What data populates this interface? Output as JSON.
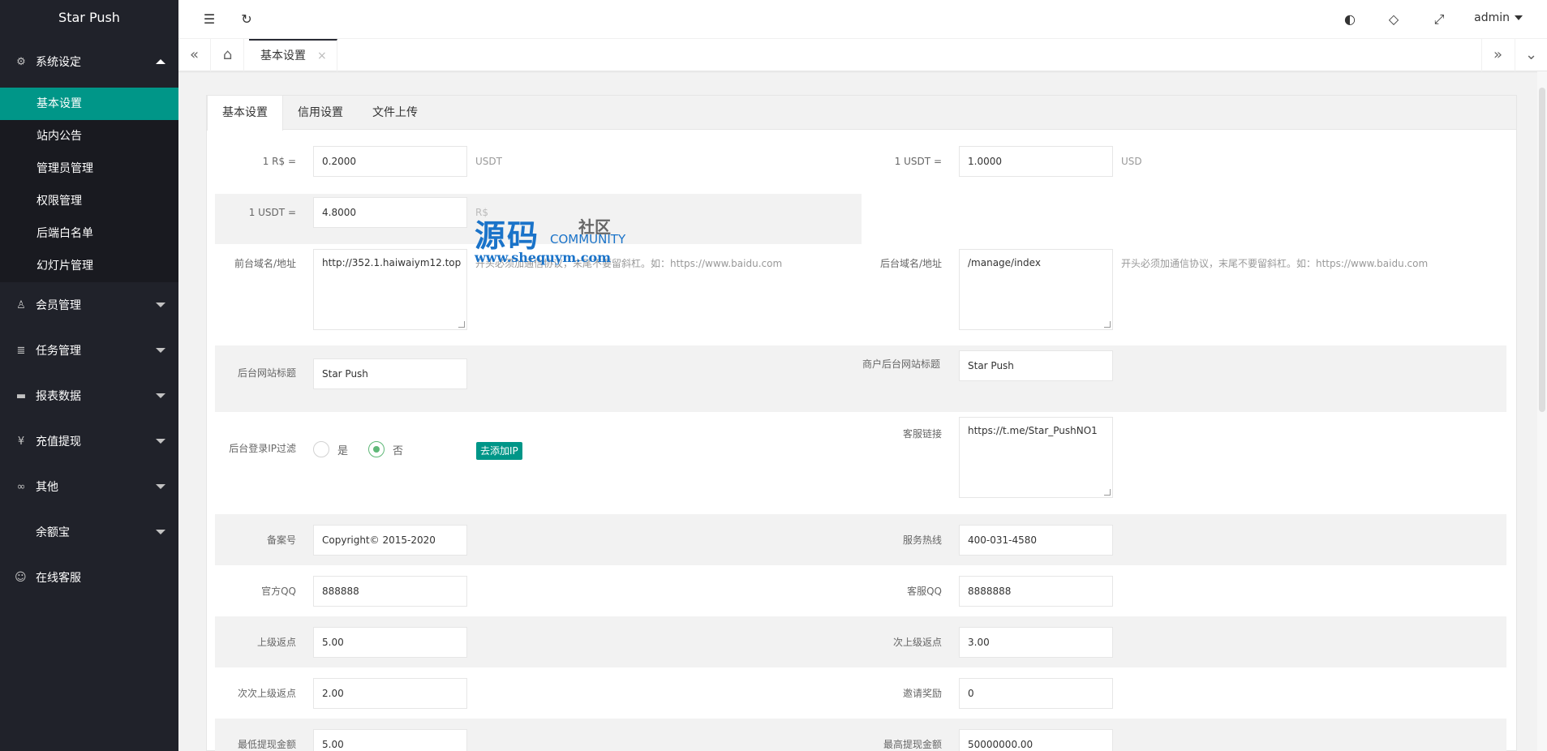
{
  "app": {
    "title": "Star Push"
  },
  "sidebar": {
    "groups": [
      {
        "label": "系统设定",
        "icon": "gear-icon",
        "expanded": true,
        "items": [
          "基本设置",
          "站内公告",
          "管理员管理",
          "权限管理",
          "后端白名单",
          "幻灯片管理"
        ],
        "active": "基本设置"
      },
      {
        "label": "会员管理",
        "icon": "user-icon"
      },
      {
        "label": "任务管理",
        "icon": "list-icon"
      },
      {
        "label": "报表数据",
        "icon": "report-icon"
      },
      {
        "label": "充值提现",
        "icon": "yen-icon"
      },
      {
        "label": "其他",
        "icon": "link-icon"
      },
      {
        "label": "余额宝",
        "icon": ""
      },
      {
        "label": "在线客服",
        "icon": "service-icon"
      }
    ]
  },
  "header": {
    "user": "admin"
  },
  "tabbar": {
    "tab_label": "基本设置",
    "close": "×"
  },
  "content": {
    "tabs": [
      "基本设置",
      "信用设置",
      "文件上传"
    ],
    "active_tab": "基本设置",
    "fields": {
      "rs_rate": {
        "label": "1 R$ =",
        "value": "0.2000",
        "unit": "USDT"
      },
      "usdt_usd": {
        "label": "1 USDT =",
        "value": "1.0000",
        "unit": "USD"
      },
      "usdt_rs": {
        "label": "1 USDT =",
        "value": "4.8000",
        "unit": "R$"
      },
      "front_domain": {
        "label": "前台域名/地址",
        "value": "http://352.1.haiwaiym12.top",
        "hint": "开头必须加通信协议，末尾不要留斜杠。如：https://www.baidu.com"
      },
      "back_domain": {
        "label": "后台域名/地址",
        "value": "/manage/index",
        "hint": "开头必须加通信协议，末尾不要留斜杠。如：https://www.baidu.com"
      },
      "admin_title": {
        "label": "后台网站标题",
        "value": "Star Push"
      },
      "merchant_title": {
        "label": "商户后台网站标题",
        "value": "Star Push"
      },
      "ip_filter": {
        "label": "后台登录IP过滤",
        "yes": "是",
        "no": "否",
        "selected": "否",
        "button": "去添加IP"
      },
      "service_link": {
        "label": "客服链接",
        "value": "https://t.me/Star_PushNO1"
      },
      "icp": {
        "label": "备案号",
        "value": "Copyright© 2015-2020"
      },
      "hotline": {
        "label": "服务热线",
        "value": "400-031-4580"
      },
      "official_qq": {
        "label": "官方QQ",
        "value": "888888"
      },
      "service_qq": {
        "label": "客服QQ",
        "value": "8888888"
      },
      "rebate1": {
        "label": "上级返点",
        "value": "5.00"
      },
      "rebate2": {
        "label": "次上级返点",
        "value": "3.00"
      },
      "rebate3": {
        "label": "次次上级返点",
        "value": "2.00"
      },
      "invite_reward": {
        "label": "邀请奖励",
        "value": "0"
      },
      "min_withdraw": {
        "label": "最低提现金额",
        "value": "5.00"
      },
      "max_withdraw": {
        "label": "最高提现金额",
        "value": "50000000.00"
      }
    }
  },
  "watermark": {
    "big": "源码",
    "small": "社区",
    "community": "COMMUNITY",
    "url": "www.shequym.com"
  },
  "colors": {
    "sidebar_bg": "#20222a",
    "active": "#009688",
    "radio_on": "#5fb878"
  }
}
